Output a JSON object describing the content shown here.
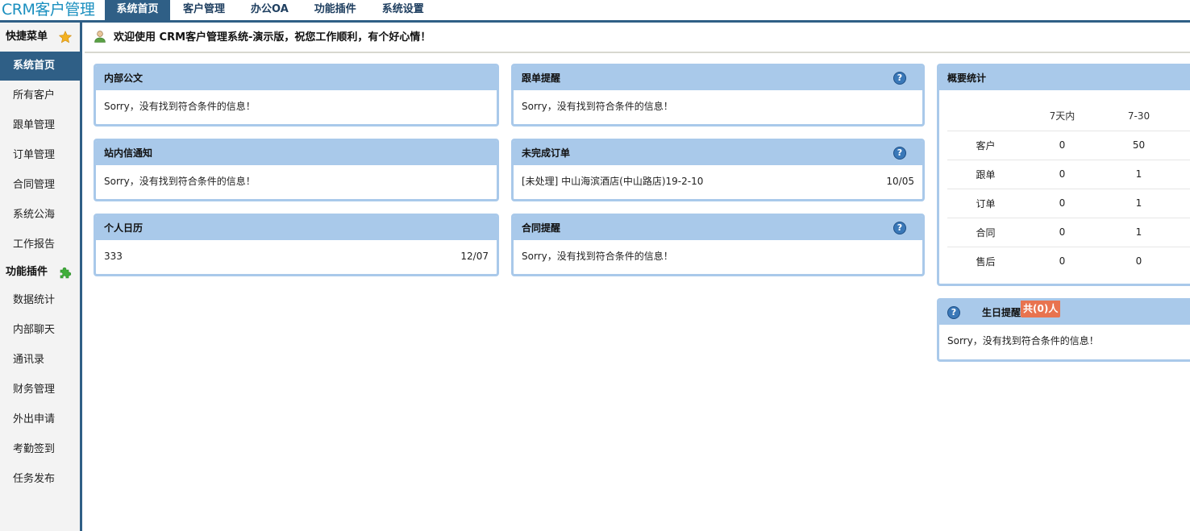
{
  "app": {
    "logo": "CRM客户管理"
  },
  "nav": {
    "tabs": [
      {
        "label": "系统首页"
      },
      {
        "label": "客户管理"
      },
      {
        "label": "办公OA"
      },
      {
        "label": "功能插件"
      },
      {
        "label": "系统设置"
      }
    ]
  },
  "sidebar": {
    "quick_title": "快捷菜单",
    "quick_items": [
      {
        "label": "系统首页"
      },
      {
        "label": "所有客户"
      },
      {
        "label": "跟单管理"
      },
      {
        "label": "订单管理"
      },
      {
        "label": "合同管理"
      },
      {
        "label": "系统公海"
      },
      {
        "label": "工作报告"
      }
    ],
    "plugin_title": "功能插件",
    "plugin_items": [
      {
        "label": "数据统计"
      },
      {
        "label": "内部聊天"
      },
      {
        "label": "通讯录"
      },
      {
        "label": "财务管理"
      },
      {
        "label": "外出申请"
      },
      {
        "label": "考勤签到"
      },
      {
        "label": "任务发布"
      }
    ]
  },
  "welcome": {
    "text": "欢迎使用 CRM客户管理系统-演示版，祝您工作顺利，有个好心情！"
  },
  "panels": {
    "notice": {
      "title": "内部公文",
      "body": "Sorry，没有找到符合条件的信息！"
    },
    "followup": {
      "title": "跟单提醒",
      "body": "Sorry，没有找到符合条件的信息！",
      "help": "?"
    },
    "messages": {
      "title": "站内信通知",
      "body": "Sorry，没有找到符合条件的信息！"
    },
    "orders": {
      "title": "未完成订单",
      "body": "[未处理] 中山海滨酒店(中山路店)19-2-10",
      "date": "10/05",
      "help": "?"
    },
    "calendar": {
      "title": "个人日历",
      "body": "333",
      "date": "12/07"
    },
    "contracts": {
      "title": "合同提醒",
      "body": "Sorry，没有找到符合条件的信息！",
      "help": "?"
    }
  },
  "stats": {
    "title": "概要统计",
    "columns": [
      "",
      "7天内",
      "7-30"
    ],
    "rows": [
      {
        "label": "客户",
        "d7": "0",
        "d30": "50"
      },
      {
        "label": "跟单",
        "d7": "0",
        "d30": "1"
      },
      {
        "label": "订单",
        "d7": "0",
        "d30": "1"
      },
      {
        "label": "合同",
        "d7": "0",
        "d30": "1"
      },
      {
        "label": "售后",
        "d7": "0",
        "d30": "0"
      }
    ]
  },
  "birthday": {
    "title": "生日提醒",
    "badge": "共(0)人",
    "body": "Sorry，没有找到符合条件的信息！",
    "help": "?"
  },
  "colors": {
    "nav_dark": "#2f5f86",
    "panel_header": "#a9c9ea",
    "logo": "#1a8fbf",
    "badge": "#e8734f"
  }
}
